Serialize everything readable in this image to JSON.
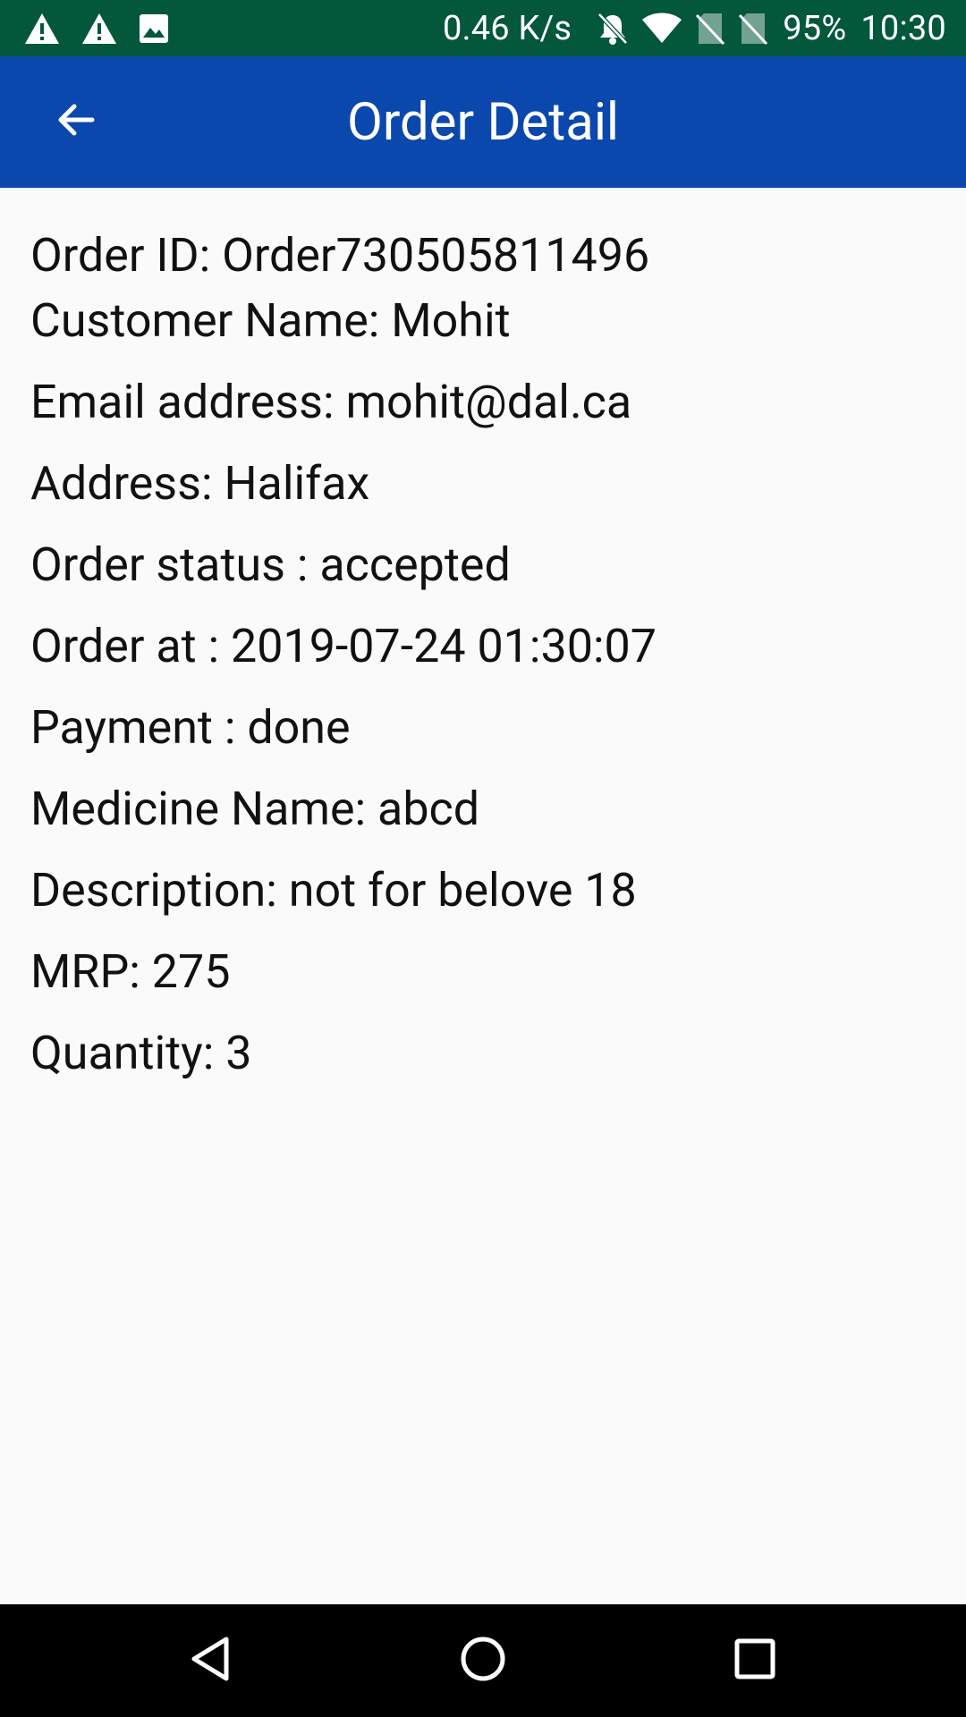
{
  "status_bar": {
    "icons_left": [
      "warning-icon",
      "warning-icon",
      "image-icon"
    ],
    "net_speed": "0.46 K/s",
    "icons_right": [
      "bell-off-icon",
      "wifi-icon",
      "no-sim-icon",
      "no-sim-icon"
    ],
    "battery": "95%",
    "time": "10:30"
  },
  "app_bar": {
    "back_icon": "arrow-back-icon",
    "title": "Order Detail"
  },
  "order": {
    "order_id": "Order ID: Order730505811496",
    "customer_name": "Customer Name: Mohit",
    "email": "Email address: mohit@dal.ca",
    "address": "Address: Halifax",
    "status": "Order status : accepted",
    "order_at": "Order at : 2019-07-24 01:30:07",
    "payment": "Payment : done",
    "medicine_name": "Medicine Name: abcd",
    "description": "Description: not for belove 18",
    "mrp": "MRP: 275",
    "quantity": "Quantity: 3"
  },
  "nav_bar": {
    "back": "nav-back-icon",
    "home": "nav-home-icon",
    "recents": "nav-recents-icon"
  },
  "colors": {
    "status_bar": "#03573a",
    "app_bar": "#0b48ad",
    "background": "#fafafa",
    "text": "#111111",
    "nav_bar": "#000000"
  }
}
